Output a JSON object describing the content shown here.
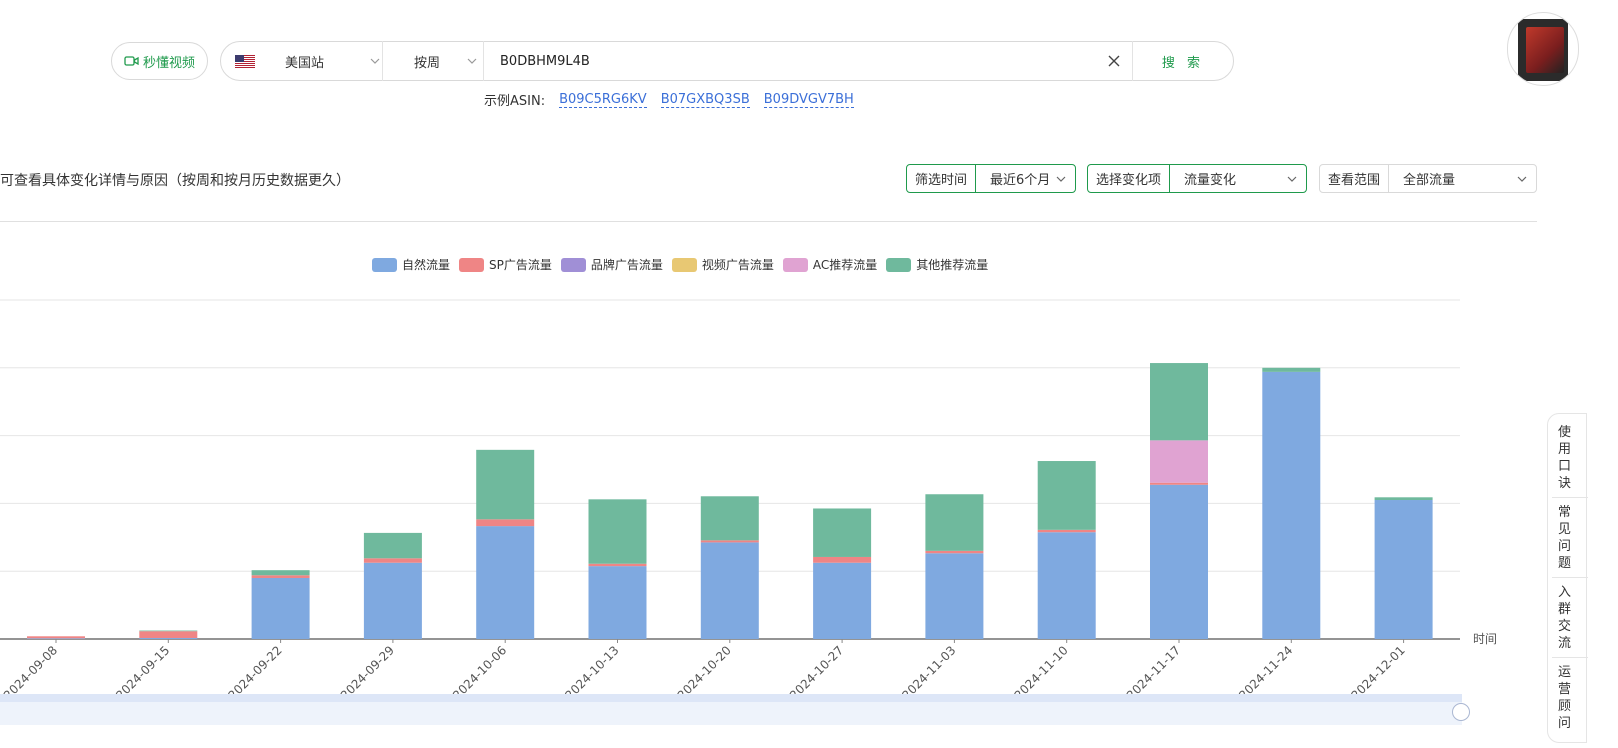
{
  "search": {
    "video_label": "秒懂视频",
    "site": "美国站",
    "period": "按周",
    "asin_value": "B0DBHM9L4B",
    "search_label": "搜 索",
    "examples_label": "示例ASIN:",
    "examples": [
      "B09C5RG6KV",
      "B07GXBQ3SB",
      "B09DVGV7BH"
    ]
  },
  "filters": {
    "info_text": "可查看具体变化详情与原因（按周和按月历史数据更久）",
    "time_label": "筛选时间",
    "time_value": "最近6个月",
    "change_label": "选择变化项",
    "change_value": "流量变化",
    "range_label": "查看范围",
    "range_value": "全部流量"
  },
  "side_panel": {
    "items": [
      "使用口诀",
      "常见问题",
      "入群交流",
      "运营顾问"
    ]
  },
  "chart_data": {
    "type": "bar",
    "stacked": true,
    "x_axis_name": "时间",
    "categories": [
      "2024-09-08",
      "2024-09-15",
      "2024-09-22",
      "2024-09-29",
      "2024-10-06",
      "2024-10-13",
      "2024-10-20",
      "2024-10-27",
      "2024-11-03",
      "2024-11-10",
      "2024-11-17",
      "2024-11-24",
      "2024-12-01"
    ],
    "ylim": [
      0,
      1000
    ],
    "gridlines": [
      0,
      200,
      400,
      600,
      800,
      1000
    ],
    "legend_position": "top-center",
    "series": [
      {
        "name": "自然流量",
        "color": "#7fa9e0",
        "values": [
          2,
          3,
          180,
          225,
          333,
          215,
          285,
          225,
          253,
          315,
          455,
          788,
          410
        ]
      },
      {
        "name": "SP广告流量",
        "color": "#ef8585",
        "values": [
          6,
          20,
          8,
          13,
          20,
          7,
          6,
          17,
          7,
          7,
          6,
          0,
          0
        ]
      },
      {
        "name": "品牌广告流量",
        "color": "#a08fd6",
        "values": [
          0,
          0,
          0,
          0,
          0,
          0,
          0,
          0,
          0,
          0,
          0,
          0,
          0
        ]
      },
      {
        "name": "视频广告流量",
        "color": "#e8c873",
        "values": [
          0,
          0,
          0,
          0,
          0,
          0,
          0,
          0,
          0,
          0,
          0,
          0,
          0
        ]
      },
      {
        "name": "AC推荐流量",
        "color": "#e0a3d2",
        "values": [
          0,
          0,
          0,
          0,
          0,
          0,
          0,
          0,
          0,
          0,
          125,
          0,
          0
        ]
      },
      {
        "name": "其他推荐流量",
        "color": "#6fb99d",
        "values": [
          0,
          2,
          15,
          75,
          205,
          190,
          130,
          143,
          167,
          203,
          228,
          12,
          8
        ]
      }
    ]
  }
}
